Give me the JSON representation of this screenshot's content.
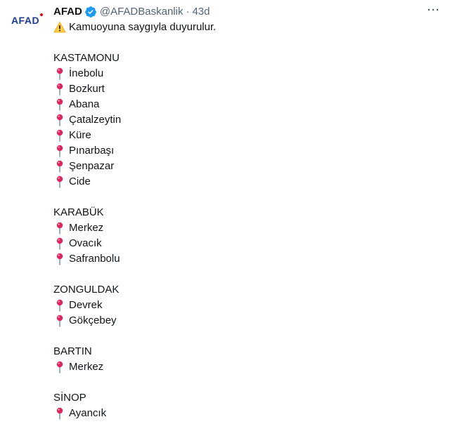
{
  "account": {
    "avatar_text": "AFAD",
    "name": "AFAD",
    "handle": "@AFADBaskanlik",
    "separator": "·",
    "time": "43d",
    "more_label": "···"
  },
  "tweet": {
    "intro": "Kamuoyuna saygıyla duyurulur.",
    "groups": [
      {
        "region": "KASTAMONU",
        "places": [
          "İnebolu",
          "Bozkurt",
          "Abana",
          "Çatalzeytin",
          "Küre",
          "Pınarbaşı",
          "Şenpazar",
          "Cide"
        ]
      },
      {
        "region": "KARABÜK",
        "places": [
          "Merkez",
          "Ovacık",
          "Safranbolu"
        ]
      },
      {
        "region": "ZONGULDAK",
        "places": [
          "Devrek",
          "Gökçebey"
        ]
      },
      {
        "region": "BARTIN",
        "places": [
          "Merkez"
        ]
      },
      {
        "region": "SİNOP",
        "places": [
          "Ayancık"
        ]
      }
    ]
  },
  "icons": {
    "verified": "verified-badge-icon",
    "warning": "warning-icon",
    "pin": "round-pushpin-icon",
    "more": "more-options-icon"
  },
  "colors": {
    "text": "#0f1419",
    "muted": "#536471",
    "verified": "#1d9bf0",
    "brand_blue": "#1a3d8f",
    "pin_red": "#e0245e"
  }
}
